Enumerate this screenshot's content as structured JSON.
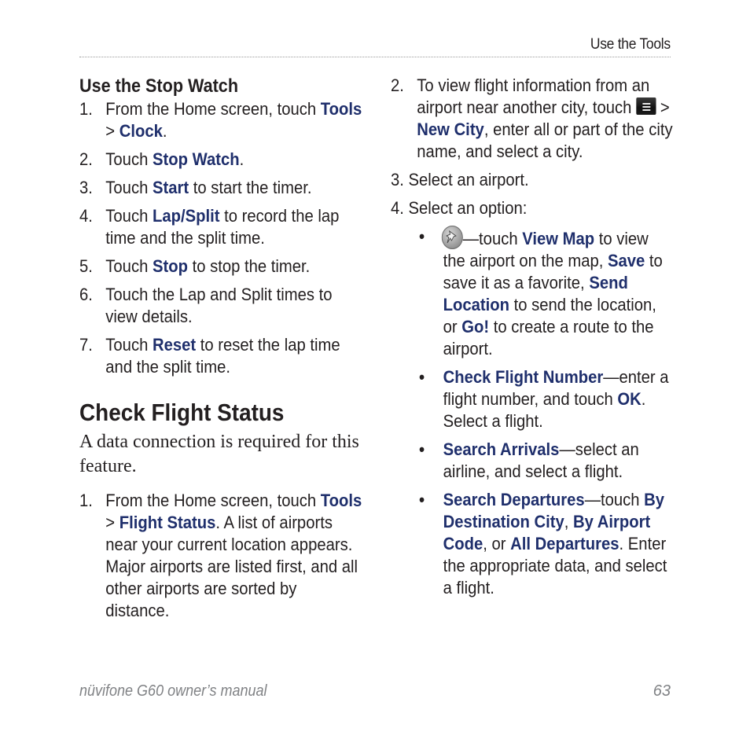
{
  "header": {
    "section_title": "Use the Tools"
  },
  "stopwatch": {
    "heading": "Use the Stop Watch",
    "steps": [
      {
        "num": "1.",
        "parts": [
          {
            "t": "From the Home screen, touch "
          },
          {
            "b": "Tools"
          },
          {
            "t": " > "
          },
          {
            "b": "Clock"
          },
          {
            "t": "."
          }
        ]
      },
      {
        "num": "2.",
        "parts": [
          {
            "t": "Touch "
          },
          {
            "b": "Stop Watch"
          },
          {
            "t": "."
          }
        ]
      },
      {
        "num": "3.",
        "parts": [
          {
            "t": "Touch "
          },
          {
            "b": "Start"
          },
          {
            "t": " to start the timer."
          }
        ]
      },
      {
        "num": "4.",
        "parts": [
          {
            "t": "Touch "
          },
          {
            "b": "Lap/Split"
          },
          {
            "t": " to record the lap time and the split time."
          }
        ]
      },
      {
        "num": "5.",
        "parts": [
          {
            "t": "Touch "
          },
          {
            "b": "Stop"
          },
          {
            "t": " to stop the timer."
          }
        ]
      },
      {
        "num": "6.",
        "parts": [
          {
            "t": "Touch the Lap and Split times to view details."
          }
        ]
      },
      {
        "num": "7.",
        "parts": [
          {
            "t": "Touch "
          },
          {
            "b": "Reset"
          },
          {
            "t": " to reset the lap time and the split time."
          }
        ]
      }
    ]
  },
  "flight_status": {
    "heading": "Check Flight Status",
    "intro": "A data connection is required for this feature.",
    "step1": {
      "num": "1.",
      "parts": [
        {
          "t": "From the Home screen, touch "
        },
        {
          "b": "Tools"
        },
        {
          "t": " > "
        },
        {
          "b": "Flight Status"
        },
        {
          "t": ". A list of airports near your current location appears. Major airports are listed first, and all other airports are sorted by distance."
        }
      ]
    },
    "step2": {
      "num": "2.",
      "before_icon": "To view flight information from an airport near another city, touch ",
      "icon": "menu-icon",
      "after_icon": [
        {
          "t": " > "
        },
        {
          "b": "New City"
        },
        {
          "t": ", enter all or part of the city name, and select a city."
        }
      ]
    },
    "step3": {
      "num": "3.",
      "text": "Select an airport."
    },
    "step4": {
      "num": "4.",
      "text": "Select an option:"
    },
    "options": [
      {
        "bullet": "•",
        "icon": "pushpin-icon",
        "parts": [
          {
            "t": "—touch "
          },
          {
            "b": "View Map"
          },
          {
            "t": " to view the airport on the map, "
          },
          {
            "b": "Save"
          },
          {
            "t": " to save it as a favorite, "
          },
          {
            "b": "Send Location"
          },
          {
            "t": " to send the location, or "
          },
          {
            "b": "Go!"
          },
          {
            "t": " to create a route to the airport."
          }
        ]
      },
      {
        "bullet": "•",
        "parts": [
          {
            "b": "Check Flight Number"
          },
          {
            "t": "—enter a flight number, and touch "
          },
          {
            "b": "OK"
          },
          {
            "t": ". Select a flight."
          }
        ]
      },
      {
        "bullet": "•",
        "parts": [
          {
            "b": "Search Arrivals"
          },
          {
            "t": "—select an airline, and select a flight."
          }
        ]
      },
      {
        "bullet": "•",
        "parts": [
          {
            "b": "Search Departures"
          },
          {
            "t": "—touch "
          },
          {
            "b": "By Destination City"
          },
          {
            "t": ", "
          },
          {
            "b": "By Airport Code"
          },
          {
            "t": ", or "
          },
          {
            "b": "All Departures"
          },
          {
            "t": ". Enter the appropriate data, and select a flight."
          }
        ]
      }
    ]
  },
  "footer": {
    "manual_title": "nüvifone G60 owner’s manual",
    "page_number": "63"
  },
  "colors": {
    "link_blue": "#1f2f6c",
    "body_text": "#231f20",
    "footer_gray": "#808285"
  }
}
